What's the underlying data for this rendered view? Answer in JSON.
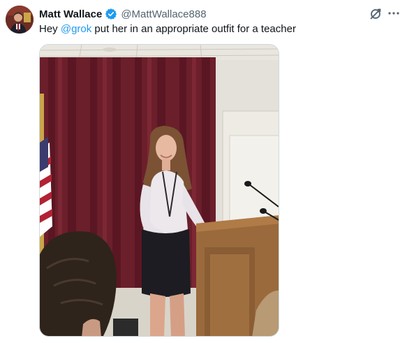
{
  "post": {
    "author_name": "Matt Wallace",
    "author_handle": "@MattWallace888",
    "verified": true,
    "text_before": "Hey ",
    "mention": "@grok",
    "text_after": " put her in an appropriate outfit for a teacher",
    "icons": {
      "avatar": "avatar",
      "verified": "verified-badge-icon",
      "grok": "grok-icon",
      "more": "more-options-icon"
    },
    "colors": {
      "accent": "#1d9bf0",
      "secondary_text": "#536471",
      "primary_text": "#0f1419"
    }
  }
}
